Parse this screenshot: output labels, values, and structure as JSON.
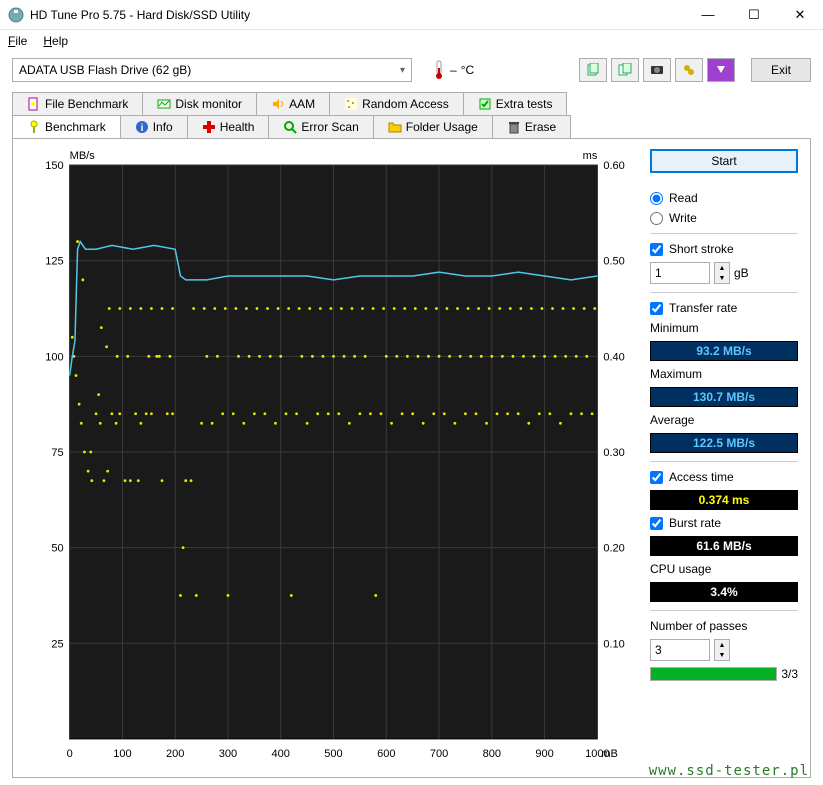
{
  "window": {
    "title": "HD Tune Pro 5.75 - Hard Disk/SSD Utility",
    "minimize": "—",
    "maximize": "☐",
    "close": "✕"
  },
  "menu": {
    "file": "File",
    "help": "Help"
  },
  "toolbar": {
    "drive": "ADATA   USB Flash Drive (62 gB)",
    "temp_sep": "–",
    "temp_unit": "°C",
    "exit": "Exit"
  },
  "tabs_row1": [
    {
      "label": "File Benchmark",
      "icon": "file-bench-icon"
    },
    {
      "label": "Disk monitor",
      "icon": "disk-monitor-icon"
    },
    {
      "label": "AAM",
      "icon": "aam-icon"
    },
    {
      "label": "Random Access",
      "icon": "random-access-icon"
    },
    {
      "label": "Extra tests",
      "icon": "extra-tests-icon"
    }
  ],
  "tabs_row2": [
    {
      "label": "Benchmark",
      "icon": "benchmark-icon",
      "active": true
    },
    {
      "label": "Info",
      "icon": "info-icon"
    },
    {
      "label": "Health",
      "icon": "health-icon"
    },
    {
      "label": "Error Scan",
      "icon": "error-scan-icon"
    },
    {
      "label": "Folder Usage",
      "icon": "folder-usage-icon"
    },
    {
      "label": "Erase",
      "icon": "erase-icon"
    }
  ],
  "side": {
    "start": "Start",
    "read": "Read",
    "write": "Write",
    "short_stroke": "Short stroke",
    "short_stroke_val": "1",
    "short_stroke_unit": "gB",
    "transfer_rate": "Transfer rate",
    "minimum_label": "Minimum",
    "minimum_value": "93.2 MB/s",
    "maximum_label": "Maximum",
    "maximum_value": "130.7 MB/s",
    "average_label": "Average",
    "average_value": "122.5 MB/s",
    "access_time_label": "Access time",
    "access_time_value": "0.374 ms",
    "burst_rate_label": "Burst rate",
    "burst_rate_value": "61.6 MB/s",
    "cpu_label": "CPU usage",
    "cpu_value": "3.4%",
    "passes_label": "Number of passes",
    "passes_value": "3",
    "progress_text": "3/3"
  },
  "chart_data": {
    "type": "line+scatter",
    "title": "",
    "x_unit": "mB",
    "xlim": [
      0,
      1000
    ],
    "x_ticks": [
      0,
      100,
      200,
      300,
      400,
      500,
      600,
      700,
      800,
      900,
      1000
    ],
    "left_axis": {
      "label": "MB/s",
      "ylim": [
        0,
        150
      ],
      "ticks": [
        25,
        50,
        75,
        100,
        125,
        150
      ]
    },
    "right_axis": {
      "label": "ms",
      "ylim": [
        0,
        0.6
      ],
      "ticks": [
        0.1,
        0.2,
        0.3,
        0.4,
        0.5,
        0.6
      ]
    },
    "series_transfer": {
      "name": "Transfer rate (MB/s)",
      "color": "#4fc8e8",
      "x": [
        0,
        5,
        10,
        15,
        20,
        25,
        30,
        50,
        80,
        120,
        160,
        200,
        210,
        220,
        260,
        300,
        350,
        400,
        450,
        500,
        550,
        600,
        650,
        700,
        750,
        800,
        850,
        900,
        950,
        1000
      ],
      "y": [
        95,
        100,
        104,
        128,
        130,
        129,
        128,
        128,
        129,
        128,
        129,
        128,
        121,
        120,
        120,
        121,
        121,
        121,
        121,
        120,
        121,
        121,
        121,
        122,
        121,
        121,
        122,
        121,
        120,
        121
      ]
    },
    "series_access": {
      "name": "Access time (ms)",
      "color": "#e8e800",
      "note": "scatter of sampled access times across the disk",
      "x": [
        5,
        8,
        12,
        18,
        22,
        28,
        35,
        42,
        50,
        58,
        65,
        72,
        80,
        88,
        95,
        105,
        115,
        125,
        135,
        145,
        155,
        165,
        175,
        185,
        195,
        210,
        230,
        250,
        270,
        290,
        310,
        330,
        350,
        370,
        390,
        410,
        430,
        450,
        470,
        490,
        510,
        530,
        550,
        570,
        590,
        610,
        630,
        650,
        670,
        690,
        710,
        730,
        750,
        770,
        790,
        810,
        830,
        850,
        870,
        890,
        910,
        930,
        950,
        970,
        990,
        60,
        70,
        90,
        110,
        130,
        150,
        170,
        190,
        220,
        240,
        260,
        280,
        300,
        320,
        340,
        360,
        380,
        400,
        420,
        440,
        460,
        480,
        500,
        520,
        540,
        560,
        580,
        600,
        620,
        640,
        660,
        680,
        700,
        720,
        740,
        760,
        780,
        800,
        820,
        840,
        860,
        880,
        900,
        920,
        940,
        960,
        980,
        15,
        25,
        40,
        55,
        75,
        95,
        115,
        135,
        155,
        175,
        195,
        215,
        235,
        255,
        275,
        295,
        315,
        335,
        355,
        375,
        395,
        415,
        435,
        455,
        475,
        495,
        515,
        535,
        555,
        575,
        595,
        615,
        635,
        655,
        675,
        695,
        715,
        735,
        755,
        775,
        795,
        815,
        835,
        855,
        875,
        895,
        915,
        935,
        955,
        975,
        995
      ],
      "y": [
        0.42,
        0.4,
        0.38,
        0.35,
        0.33,
        0.3,
        0.28,
        0.27,
        0.34,
        0.33,
        0.27,
        0.28,
        0.34,
        0.33,
        0.34,
        0.27,
        0.27,
        0.34,
        0.33,
        0.34,
        0.34,
        0.4,
        0.27,
        0.34,
        0.34,
        0.15,
        0.27,
        0.33,
        0.33,
        0.34,
        0.34,
        0.33,
        0.34,
        0.34,
        0.33,
        0.34,
        0.34,
        0.33,
        0.34,
        0.34,
        0.34,
        0.33,
        0.34,
        0.34,
        0.34,
        0.33,
        0.34,
        0.34,
        0.33,
        0.34,
        0.34,
        0.33,
        0.34,
        0.34,
        0.33,
        0.34,
        0.34,
        0.34,
        0.33,
        0.34,
        0.34,
        0.33,
        0.34,
        0.34,
        0.34,
        0.43,
        0.41,
        0.4,
        0.4,
        0.27,
        0.4,
        0.4,
        0.4,
        0.27,
        0.15,
        0.4,
        0.4,
        0.15,
        0.4,
        0.4,
        0.4,
        0.4,
        0.4,
        0.15,
        0.4,
        0.4,
        0.4,
        0.4,
        0.4,
        0.4,
        0.4,
        0.15,
        0.4,
        0.4,
        0.4,
        0.4,
        0.4,
        0.4,
        0.4,
        0.4,
        0.4,
        0.4,
        0.4,
        0.4,
        0.4,
        0.4,
        0.4,
        0.4,
        0.4,
        0.4,
        0.4,
        0.4,
        0.52,
        0.48,
        0.3,
        0.36,
        0.45,
        0.45,
        0.45,
        0.45,
        0.45,
        0.45,
        0.45,
        0.2,
        0.45,
        0.45,
        0.45,
        0.45,
        0.45,
        0.45,
        0.45,
        0.45,
        0.45,
        0.45,
        0.45,
        0.45,
        0.45,
        0.45,
        0.45,
        0.45,
        0.45,
        0.45,
        0.45,
        0.45,
        0.45,
        0.45,
        0.45,
        0.45,
        0.45,
        0.45,
        0.45,
        0.45,
        0.45,
        0.45,
        0.45,
        0.45,
        0.45,
        0.45,
        0.45,
        0.45,
        0.45,
        0.45,
        0.45
      ]
    }
  },
  "watermark": "www.ssd-tester.pl"
}
